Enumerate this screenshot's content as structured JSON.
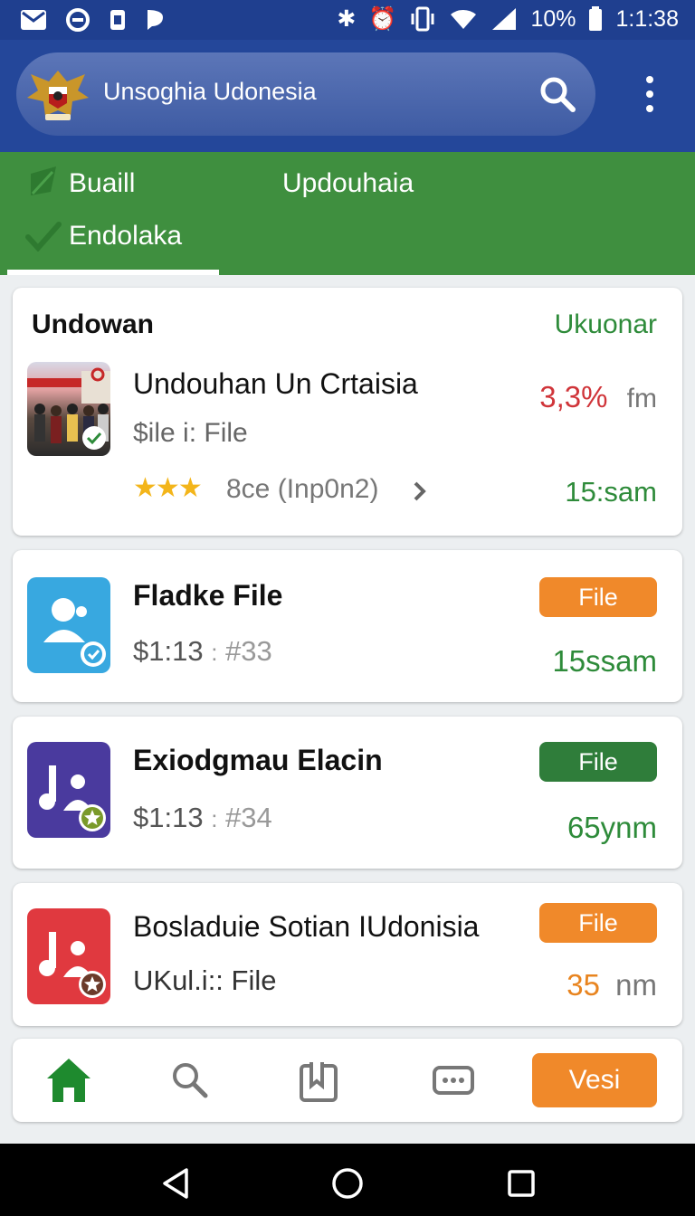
{
  "status_bar": {
    "battery": "10%",
    "time": "1:1:38"
  },
  "header": {
    "title": "Unsoghia Udonesia"
  },
  "tabs": [
    {
      "label": "Buaill"
    },
    {
      "label": "Updouhaia"
    },
    {
      "label": "Endolaka"
    }
  ],
  "featured": {
    "heading": "Undowan",
    "action": "Ukuonar",
    "title": "Undouhan Un Crtaisia",
    "subtitle": "$ile i: File",
    "rating_stars": 3,
    "rating_text": "8ce (Inp0n2)",
    "percent": "3,3%",
    "percent_unit": "fm",
    "time": "15:sam"
  },
  "items": [
    {
      "title": "Fladke File",
      "subtitle_main": "$1:13",
      "subtitle_sep": ":",
      "subtitle_tail": "#33",
      "badge": "File",
      "badge_color": "#f0892a",
      "time": "15ssam",
      "time_color": "#2e8b3a",
      "icon_bg": "#38a8e0"
    },
    {
      "title": "Exiodgmau Elacin",
      "subtitle_main": "$1:13",
      "subtitle_sep": ":",
      "subtitle_tail": "#34",
      "badge": "File",
      "badge_color": "#2f7d3a",
      "time": "65ynm",
      "time_color": "#2e8b3a",
      "icon_bg": "#4a3a9e"
    },
    {
      "title": "Bosladuie Sotian IUdonisia",
      "subtitle_main": "UKul.i:: File",
      "subtitle_sep": "",
      "subtitle_tail": "",
      "badge": "File",
      "badge_color": "#f0892a",
      "time": "35",
      "time_unit": "nm",
      "time_color": "#e8841f",
      "icon_bg": "#e0393f"
    }
  ],
  "bottom_nav": {
    "action_label": "Vesi",
    "action_color": "#f0892a"
  },
  "colors": {
    "header": "#24479a",
    "tabs": "#3f8f3f",
    "accent_orange": "#f0892a",
    "green": "#2e8b3a"
  }
}
